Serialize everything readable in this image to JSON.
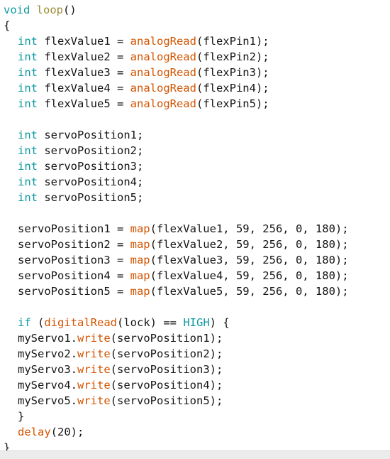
{
  "editor": {
    "language": "arduino-c",
    "font_size_px": 15.5,
    "line_height_px": 22,
    "background": "#ffffff",
    "colors": {
      "plain": "#141414",
      "keyword": "#0e9aa0",
      "function": "#d35400",
      "identifier": "#9b8b34",
      "status_bar": "#ececec"
    },
    "lines": [
      {
        "indent": 0,
        "tokens": [
          {
            "t": "void",
            "c": "keyword"
          },
          {
            "t": " ",
            "c": "plain"
          },
          {
            "t": "loop",
            "c": "ident"
          },
          {
            "t": "()",
            "c": "plain"
          }
        ]
      },
      {
        "indent": 0,
        "tokens": [
          {
            "t": "{",
            "c": "plain"
          }
        ]
      },
      {
        "indent": 1,
        "tokens": [
          {
            "t": "int",
            "c": "keyword"
          },
          {
            "t": " flexValue1 = ",
            "c": "plain"
          },
          {
            "t": "analogRead",
            "c": "func"
          },
          {
            "t": "(flexPin1);",
            "c": "plain"
          }
        ]
      },
      {
        "indent": 1,
        "tokens": [
          {
            "t": "int",
            "c": "keyword"
          },
          {
            "t": " flexValue2 = ",
            "c": "plain"
          },
          {
            "t": "analogRead",
            "c": "func"
          },
          {
            "t": "(flexPin2);",
            "c": "plain"
          }
        ]
      },
      {
        "indent": 1,
        "tokens": [
          {
            "t": "int",
            "c": "keyword"
          },
          {
            "t": " flexValue3 = ",
            "c": "plain"
          },
          {
            "t": "analogRead",
            "c": "func"
          },
          {
            "t": "(flexPin3);",
            "c": "plain"
          }
        ]
      },
      {
        "indent": 1,
        "tokens": [
          {
            "t": "int",
            "c": "keyword"
          },
          {
            "t": " flexValue4 = ",
            "c": "plain"
          },
          {
            "t": "analogRead",
            "c": "func"
          },
          {
            "t": "(flexPin4);",
            "c": "plain"
          }
        ]
      },
      {
        "indent": 1,
        "tokens": [
          {
            "t": "int",
            "c": "keyword"
          },
          {
            "t": " flexValue5 = ",
            "c": "plain"
          },
          {
            "t": "analogRead",
            "c": "func"
          },
          {
            "t": "(flexPin5);",
            "c": "plain"
          }
        ]
      },
      {
        "indent": 0,
        "tokens": []
      },
      {
        "indent": 1,
        "tokens": [
          {
            "t": "int",
            "c": "keyword"
          },
          {
            "t": " servoPosition1;",
            "c": "plain"
          }
        ]
      },
      {
        "indent": 1,
        "tokens": [
          {
            "t": "int",
            "c": "keyword"
          },
          {
            "t": " servoPosition2;",
            "c": "plain"
          }
        ]
      },
      {
        "indent": 1,
        "tokens": [
          {
            "t": "int",
            "c": "keyword"
          },
          {
            "t": " servoPosition3;",
            "c": "plain"
          }
        ]
      },
      {
        "indent": 1,
        "tokens": [
          {
            "t": "int",
            "c": "keyword"
          },
          {
            "t": " servoPosition4;",
            "c": "plain"
          }
        ]
      },
      {
        "indent": 1,
        "tokens": [
          {
            "t": "int",
            "c": "keyword"
          },
          {
            "t": " servoPosition5;",
            "c": "plain"
          }
        ]
      },
      {
        "indent": 0,
        "tokens": []
      },
      {
        "indent": 1,
        "tokens": [
          {
            "t": "servoPosition1 = ",
            "c": "plain"
          },
          {
            "t": "map",
            "c": "func"
          },
          {
            "t": "(flexValue1, 59, 256, 0, 180);",
            "c": "plain"
          }
        ]
      },
      {
        "indent": 1,
        "tokens": [
          {
            "t": "servoPosition2 = ",
            "c": "plain"
          },
          {
            "t": "map",
            "c": "func"
          },
          {
            "t": "(flexValue2, 59, 256, 0, 180);",
            "c": "plain"
          }
        ]
      },
      {
        "indent": 1,
        "tokens": [
          {
            "t": "servoPosition3 = ",
            "c": "plain"
          },
          {
            "t": "map",
            "c": "func"
          },
          {
            "t": "(flexValue3, 59, 256, 0, 180);",
            "c": "plain"
          }
        ]
      },
      {
        "indent": 1,
        "tokens": [
          {
            "t": "servoPosition4 = ",
            "c": "plain"
          },
          {
            "t": "map",
            "c": "func"
          },
          {
            "t": "(flexValue4, 59, 256, 0, 180);",
            "c": "plain"
          }
        ]
      },
      {
        "indent": 1,
        "tokens": [
          {
            "t": "servoPosition5 = ",
            "c": "plain"
          },
          {
            "t": "map",
            "c": "func"
          },
          {
            "t": "(flexValue5, 59, 256, 0, 180);",
            "c": "plain"
          }
        ]
      },
      {
        "indent": 0,
        "tokens": []
      },
      {
        "indent": 1,
        "tokens": [
          {
            "t": "if",
            "c": "keyword"
          },
          {
            "t": " (",
            "c": "plain"
          },
          {
            "t": "digitalRead",
            "c": "func"
          },
          {
            "t": "(lock) == ",
            "c": "plain"
          },
          {
            "t": "HIGH",
            "c": "const"
          },
          {
            "t": ") {",
            "c": "plain"
          }
        ]
      },
      {
        "indent": 1,
        "tokens": [
          {
            "t": "myServo1.",
            "c": "plain"
          },
          {
            "t": "write",
            "c": "func"
          },
          {
            "t": "(servoPosition1);",
            "c": "plain"
          }
        ]
      },
      {
        "indent": 1,
        "tokens": [
          {
            "t": "myServo2.",
            "c": "plain"
          },
          {
            "t": "write",
            "c": "func"
          },
          {
            "t": "(servoPosition2);",
            "c": "plain"
          }
        ]
      },
      {
        "indent": 1,
        "tokens": [
          {
            "t": "myServo3.",
            "c": "plain"
          },
          {
            "t": "write",
            "c": "func"
          },
          {
            "t": "(servoPosition3);",
            "c": "plain"
          }
        ]
      },
      {
        "indent": 1,
        "tokens": [
          {
            "t": "myServo4.",
            "c": "plain"
          },
          {
            "t": "write",
            "c": "func"
          },
          {
            "t": "(servoPosition4);",
            "c": "plain"
          }
        ]
      },
      {
        "indent": 1,
        "tokens": [
          {
            "t": "myServo5.",
            "c": "plain"
          },
          {
            "t": "write",
            "c": "func"
          },
          {
            "t": "(servoPosition5);",
            "c": "plain"
          }
        ]
      },
      {
        "indent": 1,
        "tokens": [
          {
            "t": "}",
            "c": "plain"
          }
        ]
      },
      {
        "indent": 1,
        "tokens": [
          {
            "t": "delay",
            "c": "func"
          },
          {
            "t": "(20);",
            "c": "plain"
          }
        ]
      },
      {
        "indent": 0,
        "tokens": [
          {
            "t": "}",
            "c": "plain"
          }
        ]
      }
    ]
  }
}
